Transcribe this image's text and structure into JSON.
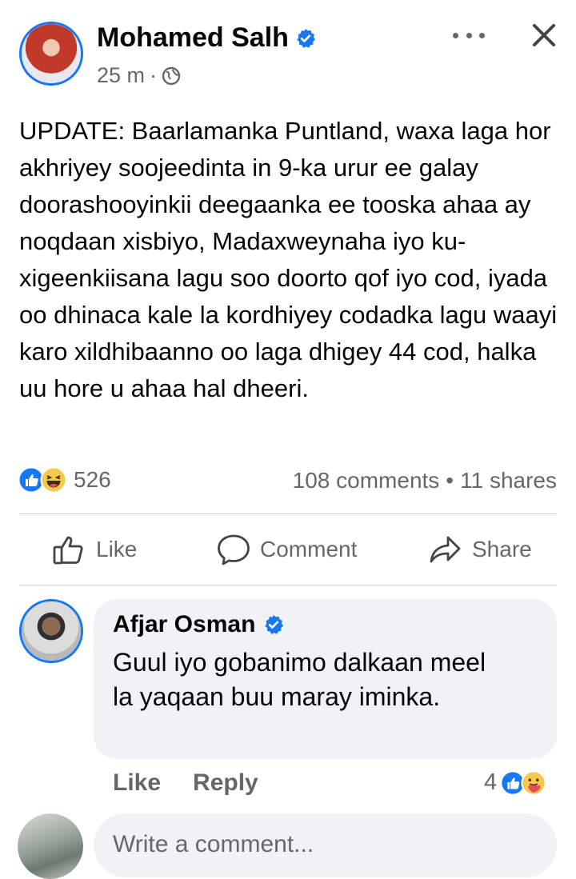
{
  "post": {
    "author": "Mohamed Salh",
    "time": "25 m",
    "separator": "·",
    "text": "UPDATE: Baarlamanka Puntland, waxa laga hor akhriyey soojeedinta in 9-ka urur ee galay doorashooyinkii deegaanka ee tooska ahaa ay noqdaan xisbiyo, Madaxweynaha iyo ku-xigeenkiisana lagu soo doorto qof iyo cod, iyada oo dhinaca kale la kordhiyey codadka lagu waayi karo xildhibaanno oo laga dhigey 44 cod, halka uu hore u ahaa hal dheeri.",
    "reaction_count": "526",
    "comments_count": "108 comments",
    "dot": "•",
    "shares_count": "11 shares"
  },
  "actions": {
    "like": "Like",
    "comment": "Comment",
    "share": "Share"
  },
  "comment": {
    "author": "Afjar Osman",
    "text": "Guul iyo gobanimo dalkaan meel la yaqaan buu maray iminka.",
    "like": "Like",
    "reply": "Reply",
    "reaction_count": "4"
  },
  "composer": {
    "placeholder": "Write a comment..."
  },
  "icons": {
    "more": "more-options-icon",
    "close": "close-icon",
    "globe": "globe-icon",
    "verified": "verified-badge-icon",
    "like_reaction": "like-reaction-icon",
    "haha_reaction": "haha-reaction-icon",
    "care_reaction": "care-reaction-icon",
    "thumb": "thumbs-up-icon",
    "speech": "comment-bubble-icon",
    "arrow": "share-arrow-icon"
  },
  "colors": {
    "accent": "#1877f2",
    "text": "#050505",
    "secondary": "#65676b",
    "bubble": "#f0f2f5"
  }
}
